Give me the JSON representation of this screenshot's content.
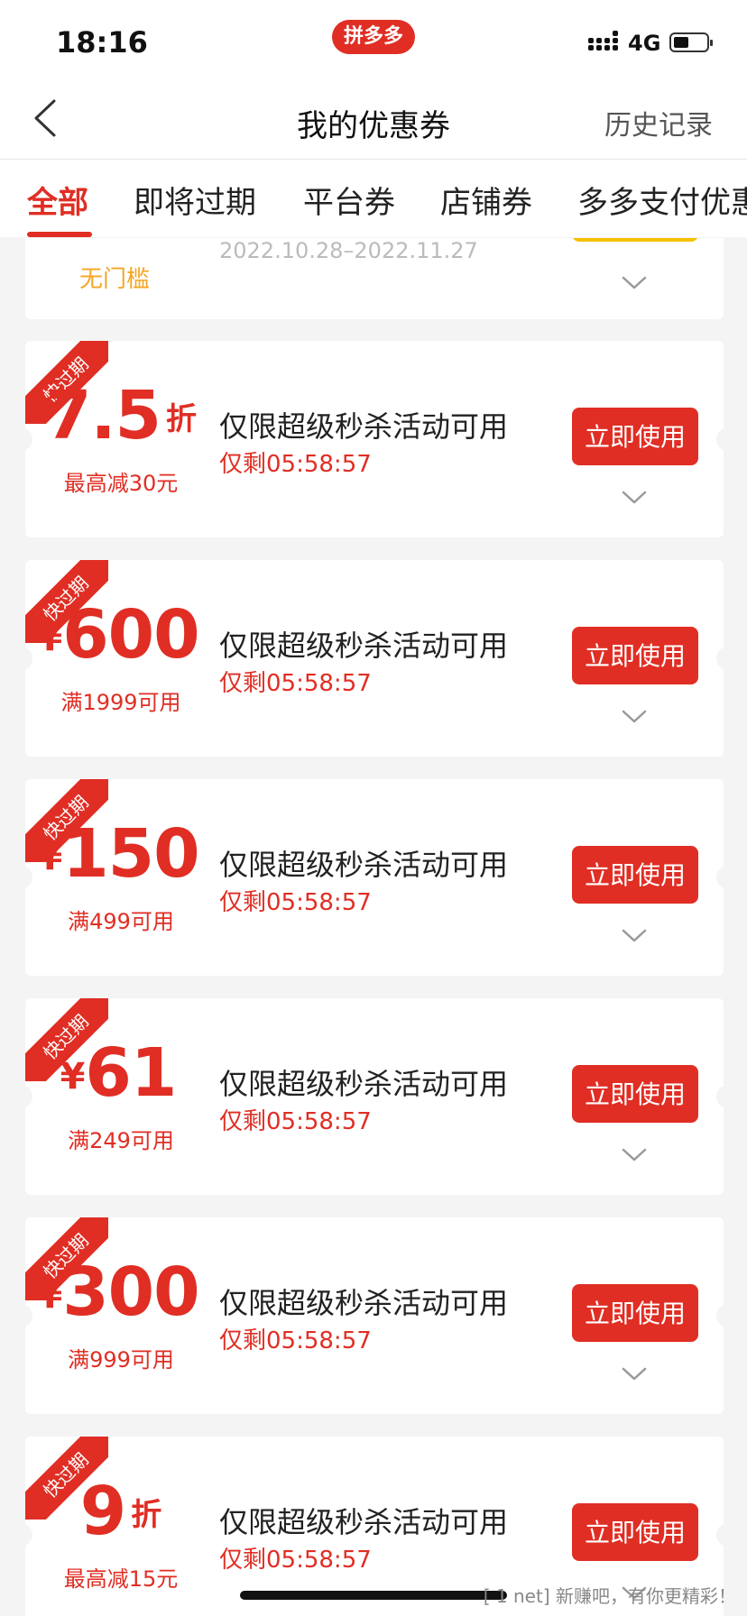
{
  "status_bar": {
    "time": "18:16",
    "app_badge": "拼多多",
    "network": "4G"
  },
  "nav": {
    "title": "我的优惠券",
    "history": "历史记录"
  },
  "tabs": [
    "全部",
    "即将过期",
    "平台券",
    "店铺券",
    "多多支付优惠"
  ],
  "partial_coupon": {
    "date": "2022.10.28–2022.11.27",
    "threshold": "无门槛"
  },
  "coupons": [
    {
      "badge": "快过期",
      "currency": "",
      "amount": "7.5",
      "unit": "折",
      "threshold": "最高减30元",
      "desc": "仅限超级秒杀活动可用",
      "countdown": "仅剩05:58:57",
      "button": "立即使用"
    },
    {
      "badge": "快过期",
      "currency": "¥",
      "amount": "600",
      "unit": "",
      "threshold": "满1999可用",
      "desc": "仅限超级秒杀活动可用",
      "countdown": "仅剩05:58:57",
      "button": "立即使用"
    },
    {
      "badge": "快过期",
      "currency": "¥",
      "amount": "150",
      "unit": "",
      "threshold": "满499可用",
      "desc": "仅限超级秒杀活动可用",
      "countdown": "仅剩05:58:57",
      "button": "立即使用"
    },
    {
      "badge": "快过期",
      "currency": "¥",
      "amount": "61",
      "unit": "",
      "threshold": "满249可用",
      "desc": "仅限超级秒杀活动可用",
      "countdown": "仅剩05:58:57",
      "button": "立即使用"
    },
    {
      "badge": "快过期",
      "currency": "¥",
      "amount": "300",
      "unit": "",
      "threshold": "满999可用",
      "desc": "仅限超级秒杀活动可用",
      "countdown": "仅剩05:58:57",
      "button": "立即使用"
    },
    {
      "badge": "快过期",
      "currency": "",
      "amount": "9",
      "unit": "折",
      "threshold": "最高减15元",
      "desc": "仅限超级秒杀活动可用",
      "countdown": "仅剩05:58:57",
      "button": "立即使用"
    }
  ],
  "watermark": "[ 1 net] 新赚吧，有你更精彩！",
  "colors": {
    "accent": "#e02e24",
    "warning": "#f5a623",
    "background": "#f4f4f4"
  }
}
